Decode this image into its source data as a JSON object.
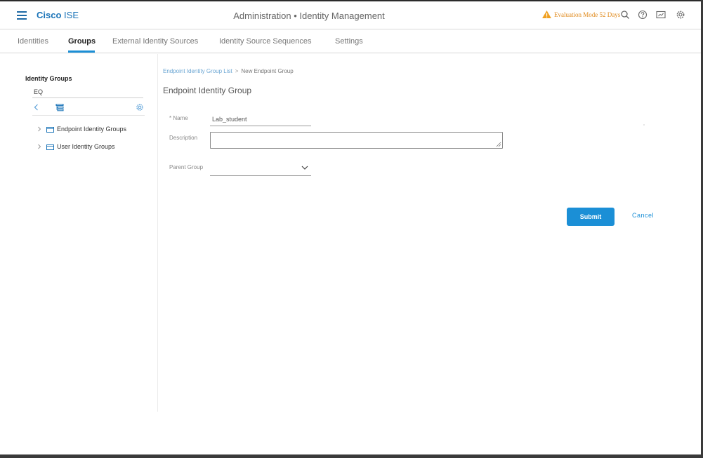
{
  "header": {
    "brand_bold": "Cisco",
    "brand_light": "ISE",
    "title": "Administration • Identity Management",
    "eval_text": "Evaluation Mode 52 Days"
  },
  "tabs": [
    {
      "label": "Identities"
    },
    {
      "label": "Groups"
    },
    {
      "label": "External Identity Sources"
    },
    {
      "label": "Identity Source Sequences"
    },
    {
      "label": "Settings"
    }
  ],
  "sidebar": {
    "title": "Identity Groups",
    "search_value": "EQ",
    "items": [
      {
        "label": "Endpoint Identity Groups"
      },
      {
        "label": "User Identity Groups"
      }
    ]
  },
  "breadcrumb": {
    "link": "Endpoint Identity Group List",
    "current": "New Endpoint Group"
  },
  "form": {
    "title": "Endpoint Identity Group",
    "name_label": "* Name",
    "name_value": "Lab_student",
    "description_label": "Description",
    "description_value": "",
    "parent_label": "Parent Group",
    "parent_value": "",
    "submit_label": "Submit",
    "cancel_label": "Cancel"
  },
  "colors": {
    "accent": "#1b8fd6",
    "brand": "#1b74b8",
    "warning": "#e0891a"
  },
  "icons": [
    "menu-icon",
    "warning-icon",
    "search-icon",
    "help-icon",
    "notifications-icon",
    "gear-icon",
    "chevron-left-icon",
    "tree-view-icon",
    "settings-icon",
    "chevron-right-icon",
    "folder-icon",
    "chevron-down-icon"
  ]
}
